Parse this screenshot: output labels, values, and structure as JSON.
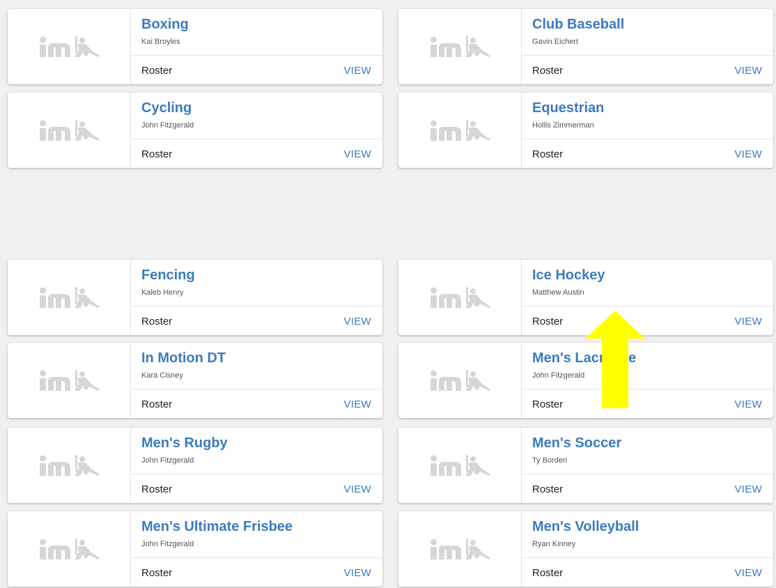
{
  "colors": {
    "accent": "#3b7bbf",
    "arrow": "#ffff00"
  },
  "logo_icon": "im-logo-icon",
  "cards": [
    {
      "team": "Boxing",
      "coach": "Kai Broyles",
      "roster_label": "Roster",
      "view_label": "VIEW"
    },
    {
      "team": "Club Baseball",
      "coach": "Gavin Eichert",
      "roster_label": "Roster",
      "view_label": "VIEW"
    },
    {
      "team": "Cycling",
      "coach": "John Fitzgerald",
      "roster_label": "Roster",
      "view_label": "VIEW"
    },
    {
      "team": "Equestrian",
      "coach": "Hollis Zimmerman",
      "roster_label": "Roster",
      "view_label": "VIEW"
    },
    {
      "team": "Fencing",
      "coach": "Kaleb Henry",
      "roster_label": "Roster",
      "view_label": "VIEW"
    },
    {
      "team": "Ice Hockey",
      "coach": "Matthew Austin",
      "roster_label": "Roster",
      "view_label": "VIEW"
    },
    {
      "team": "In Motion DT",
      "coach": "Kara Cisney",
      "roster_label": "Roster",
      "view_label": "VIEW"
    },
    {
      "team": "Men's Lacrosse",
      "coach": "John Fitzgerald",
      "roster_label": "Roster",
      "view_label": "VIEW"
    },
    {
      "team": "Men's Rugby",
      "coach": "John Fitzgerald",
      "roster_label": "Roster",
      "view_label": "VIEW"
    },
    {
      "team": "Men's Soccer",
      "coach": "Ty Borden",
      "roster_label": "Roster",
      "view_label": "VIEW"
    },
    {
      "team": "Men's Ultimate Frisbee",
      "coach": "John Fitzgerald",
      "roster_label": "Roster",
      "view_label": "VIEW"
    },
    {
      "team": "Men's Volleyball",
      "coach": "Ryan Kinney",
      "roster_label": "Roster",
      "view_label": "VIEW"
    }
  ]
}
